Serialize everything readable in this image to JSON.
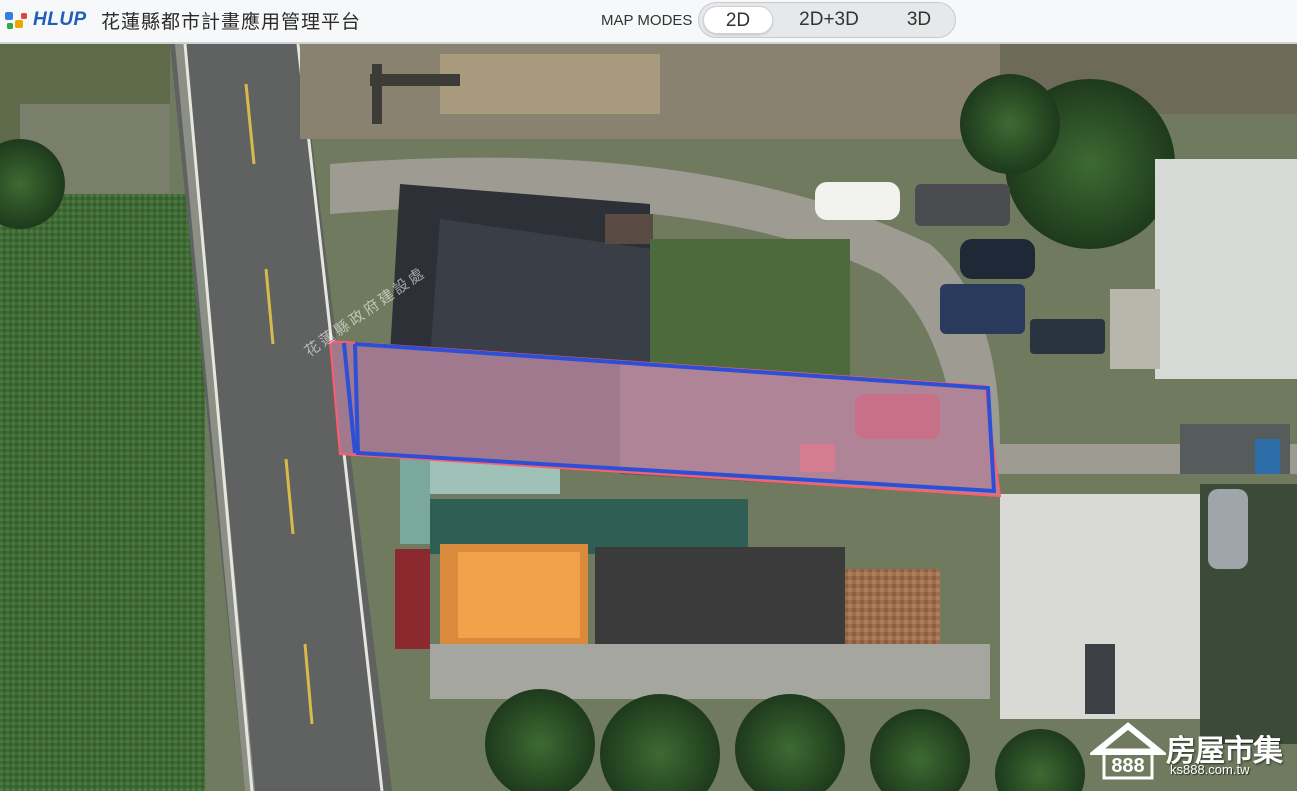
{
  "header": {
    "logo_text": "HLUP",
    "title": "花蓮縣都市計畫應用管理平台",
    "map_modes_label": "MAP MODES",
    "modes": [
      {
        "label": "2D",
        "active": true
      },
      {
        "label": "2D+3D",
        "active": false
      },
      {
        "label": "3D",
        "active": false
      }
    ]
  },
  "map": {
    "layer_label": "花蓮縣政府建設處",
    "parcel_fill_color": "#e8a5c8",
    "parcel_outline_color": "#2d4fd6",
    "parcel_edge_color": "#ff5c6e"
  },
  "watermark": {
    "brand": "房屋市集",
    "number": "888",
    "url": "ks888.com.tw"
  },
  "colors": {
    "accent": "#1f5fb8",
    "header_bg": "#f7f8f9"
  }
}
